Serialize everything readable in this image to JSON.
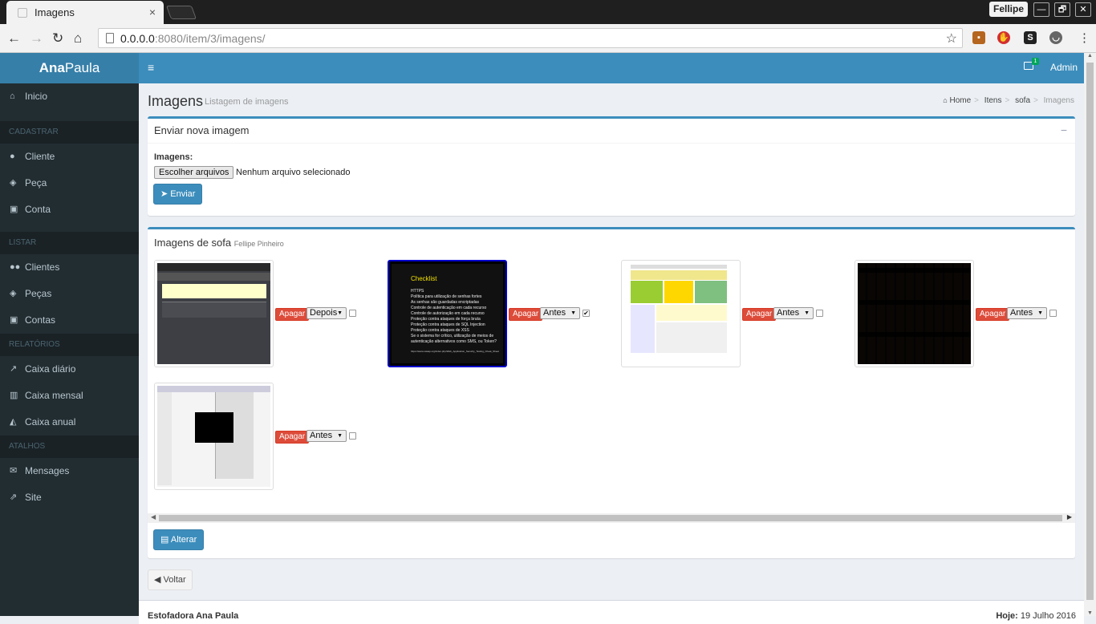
{
  "browser": {
    "tab_title": "Imagens",
    "tab_close": "×",
    "profile_name": "Fellipe",
    "url_host": "0.0.0.0",
    "url_rest": ":8080/item/3/imagens/",
    "window_buttons": [
      "—",
      "🗗",
      "✕"
    ]
  },
  "sidebar": {
    "brand_bold": "Ana",
    "brand_rest": "Paula",
    "items": [
      {
        "label": "Inicio"
      },
      {
        "header": "CADASTRAR"
      },
      {
        "label": "Cliente"
      },
      {
        "label": "Peça"
      },
      {
        "label": "Conta"
      },
      {
        "header": "LISTAR"
      },
      {
        "label": "Clientes"
      },
      {
        "label": "Peças"
      },
      {
        "label": "Contas"
      },
      {
        "header": "RELATÓRIOS"
      },
      {
        "label": "Caixa diário"
      },
      {
        "label": "Caixa mensal"
      },
      {
        "label": "Caixa anual"
      },
      {
        "header": "ATALHOS"
      },
      {
        "label": "Mensages"
      },
      {
        "label": "Site"
      }
    ]
  },
  "topbar": {
    "hamburger": "≡",
    "mail_count": "1",
    "user": "Admin"
  },
  "page": {
    "title": "Imagens",
    "subtitle": "Listagem de imagens",
    "breadcrumb": [
      "Home",
      "Itens",
      "sofa",
      "Imagens"
    ]
  },
  "upload": {
    "title": "Enviar nova imagem",
    "collapse": "−",
    "field_label": "Imagens:",
    "file_button": "Escolher arquivos",
    "file_status": "Nenhum arquivo selecionado",
    "submit": "Enviar"
  },
  "gallery": {
    "title": "Imagens de sofa",
    "owner": "Fellipe Pinheiro",
    "delete_label": "Apagar",
    "images": [
      {
        "order": "Depois",
        "checked": false,
        "selected": false,
        "kind": "app-window"
      },
      {
        "order": "Antes",
        "checked": true,
        "selected": true,
        "kind": "checklist",
        "slide_title": "Checklist",
        "slide_lines": [
          "HTTPS",
          "Política para utilização de senhas fortes",
          "As senhas são guardadas encriptadas",
          "Controle de autenticação em cada recurso",
          "Controle de autorização em cada recurso",
          "Proteção contra ataques de força bruta",
          "Proteção contra ataques de SQL Injection",
          "Proteção contra ataques de XSS",
          "Se o sistema for crítico, utilização de meios de autenticação alternativos como SMS, ou Token?"
        ],
        "slide_link": "https://www.owasp.org/index.php/Web_Application_Security_Testing_Cheat_Sheet"
      },
      {
        "order": "Antes",
        "checked": false,
        "selected": false,
        "kind": "colorful-table"
      },
      {
        "order": "Antes",
        "checked": false,
        "selected": false,
        "kind": "poster-grid"
      },
      {
        "order": "Antes",
        "checked": false,
        "selected": false,
        "kind": "code-editor"
      }
    ],
    "update_button": "Alterar"
  },
  "back_button": "Voltar",
  "footer": {
    "left": "Estofadora Ana Paula",
    "right_bold": "Hoje:",
    "right_date": "19 Julho 2016"
  },
  "colors": {
    "primary": "#3c8dbc",
    "danger": "#dd4b39",
    "sidebar": "#222d32"
  }
}
